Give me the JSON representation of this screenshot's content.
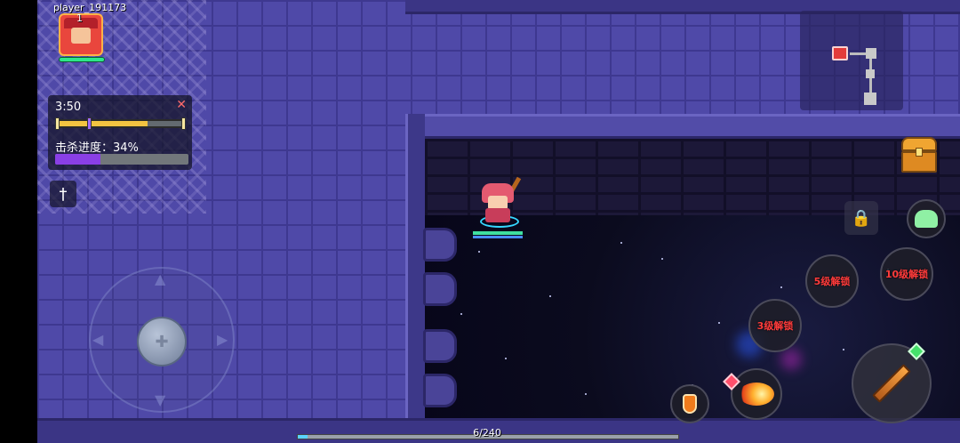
{
  "player": {
    "name": "player_191173",
    "level": "1",
    "hp_fraction": 1.0
  },
  "wave": {
    "timer": "3:50",
    "close_icon": "✕",
    "progress_fraction": 0.72
  },
  "kill_progress": {
    "label": "击杀进度：34%",
    "fraction": 0.34
  },
  "skills": {
    "lock_icon": "lock-icon",
    "unlock_level5": "5级解锁",
    "unlock_level10": "10级解锁",
    "unlock_level3": "3级解锁"
  },
  "xp": {
    "text": "6/240",
    "fraction": 0.025
  },
  "colors": {
    "floor": "#4f49a8",
    "kill_fill": "#8a3fe6",
    "wave_fill": "#f3c441",
    "locked_text": "#ff3b3b"
  }
}
